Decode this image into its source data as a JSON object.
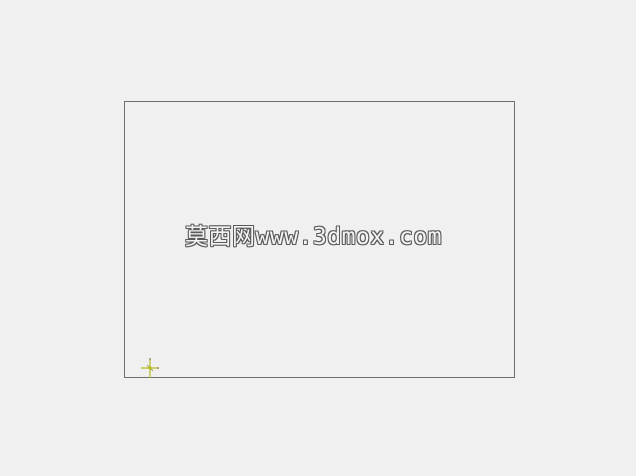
{
  "watermark": {
    "text": "莫西网www.3dmox.com"
  },
  "gizmo": {
    "icon": "axis-gizmo-icon",
    "color": "#b8b81e"
  },
  "colors": {
    "background": "#f0f0f0",
    "frame": "#6e6e6e"
  }
}
